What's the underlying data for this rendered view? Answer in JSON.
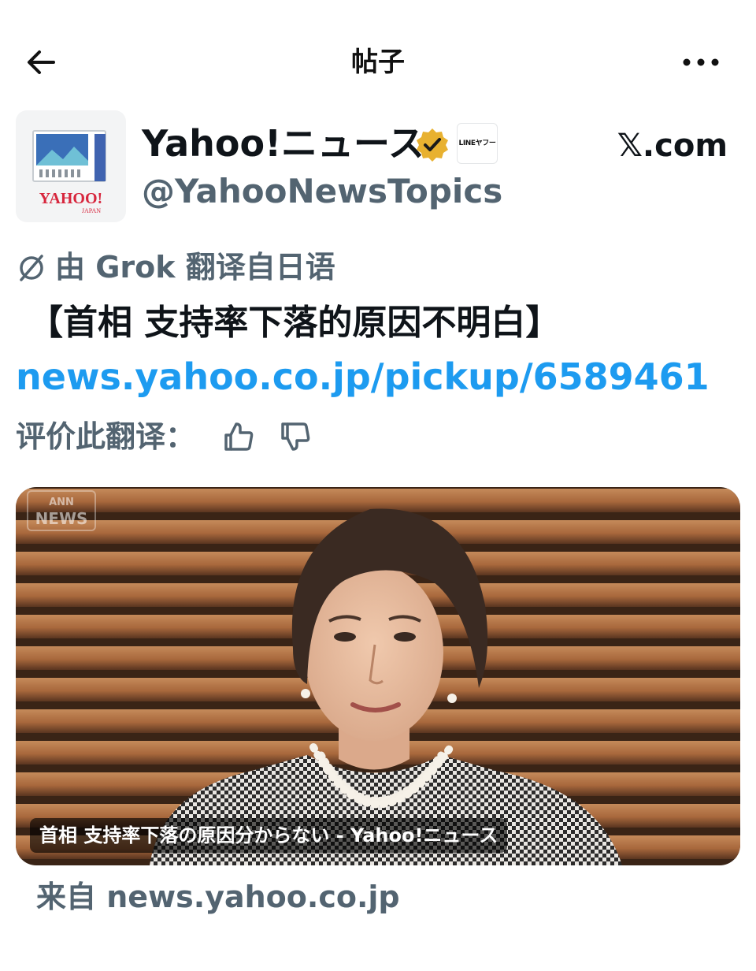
{
  "topbar": {
    "title": "帖子",
    "back_icon": "arrow-left-icon",
    "more_icon": "more-horizontal-icon"
  },
  "author": {
    "name": "Yahoo!ニュース",
    "handle": "@YahooNewsTopics",
    "avatar_logo_text": "YAHOO!",
    "avatar_logo_subtext": "JAPAN",
    "verified_icon": "verified-gold-badge-icon",
    "affiliate_badge_text": "LINEヤフー"
  },
  "source_domain": "𝕏.com",
  "translation": {
    "icon": "translate-slash-icon",
    "note": "由 Grok 翻译自日语"
  },
  "post": {
    "text": "【首相 支持率下落的原因不明白】",
    "link": "news.yahoo.co.jp/pickup/6589461"
  },
  "rate": {
    "label": "评价此翻译：",
    "thumb_up_icon": "thumbs-up-icon",
    "thumb_down_icon": "thumbs-down-icon"
  },
  "media": {
    "watermark_top": "ANN",
    "watermark_bottom": "NEWS",
    "caption": "首相 支持率下落の原因分からない - Yahoo!ニュース"
  },
  "from": "来自 news.yahoo.co.jp",
  "colors": {
    "text_primary": "#0f1419",
    "text_secondary": "#536471",
    "link": "#1d9bf0",
    "verified_gold": "#e8b130",
    "yahoo_red": "#d7263d"
  }
}
